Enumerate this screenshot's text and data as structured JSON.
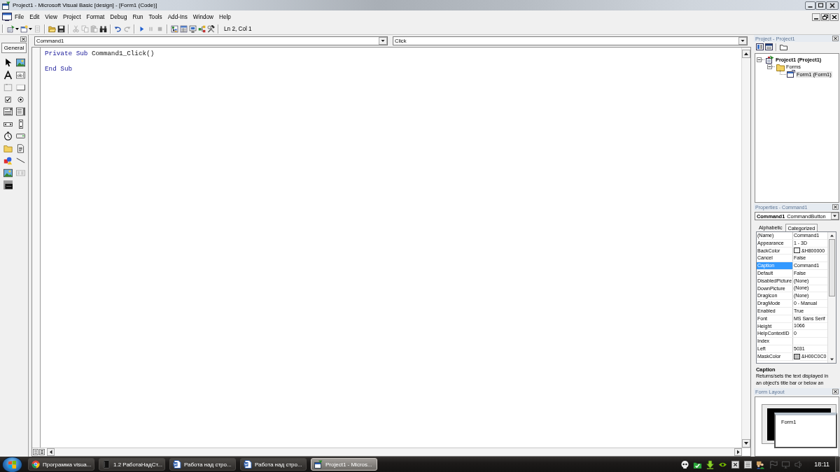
{
  "window": {
    "title": "Project1 - Microsoft Visual Basic [design] - [Form1 (Code)]"
  },
  "menu_bar": {
    "items": [
      "File",
      "Edit",
      "View",
      "Project",
      "Format",
      "Debug",
      "Run",
      "Tools",
      "Add-Ins",
      "Window",
      "Help"
    ]
  },
  "toolbar": {
    "buttons": [
      {
        "disabled": false
      },
      {
        "disabled": false
      },
      {
        "disabled": true
      },
      {
        "disabled": false
      },
      {
        "disabled": false
      },
      {
        "disabled": true
      },
      {
        "disabled": true
      },
      {
        "disabled": true
      },
      {
        "disabled": false
      },
      {
        "disabled": false
      },
      {
        "disabled": true
      },
      {
        "disabled": false
      },
      {
        "disabled": true
      },
      {
        "disabled": true
      },
      {
        "disabled": false
      },
      {
        "disabled": false
      },
      {
        "disabled": false
      },
      {
        "disabled": false
      },
      {
        "disabled": false
      }
    ],
    "position": "Ln 2, Col 1"
  },
  "toolbox": {
    "tab": "General"
  },
  "code_window": {
    "object": "Command1",
    "procedure": "Click",
    "lines": [
      {
        "kind": "code",
        "tokens": [
          {
            "text": "Private Sub",
            "kind": "keyword"
          },
          {
            "text": " Command1_Click()",
            "kind": "plain"
          }
        ]
      },
      {
        "kind": "blank"
      },
      {
        "kind": "code",
        "tokens": [
          {
            "text": "End Sub",
            "kind": "keyword"
          }
        ]
      }
    ]
  },
  "project_explorer": {
    "title": "Project - Project1",
    "tree": [
      {
        "label": "Project1 (Project1)",
        "kind": "project",
        "expanded": true,
        "selected": false,
        "children": [
          {
            "label": "Forms",
            "kind": "folder",
            "expanded": true,
            "selected": false,
            "children": [
              {
                "label": "Form1 (Form1)",
                "kind": "form",
                "selected": true
              }
            ]
          }
        ]
      }
    ]
  },
  "properties": {
    "title": "Properties - Command1",
    "object": {
      "name": "Command1",
      "type": "CommandButton"
    },
    "tabs": [
      {
        "label": "Alphabetic",
        "selected": true
      },
      {
        "label": "Categorized",
        "selected": false
      }
    ],
    "rows": [
      {
        "name": "(Name)",
        "value": "Command1",
        "selected": false
      },
      {
        "name": "Appearance",
        "value": "1 - 3D",
        "selected": false
      },
      {
        "name": "BackColor",
        "value": "&H800000",
        "color": "#f4f4f4",
        "selected": false
      },
      {
        "name": "Cancel",
        "value": "False",
        "selected": false
      },
      {
        "name": "Caption",
        "value": "Command1",
        "selected": true
      },
      {
        "name": "Default",
        "value": "False",
        "selected": false
      },
      {
        "name": "DisabledPicture",
        "value": "(None)",
        "selected": false
      },
      {
        "name": "DownPicture",
        "value": "(None)",
        "selected": false
      },
      {
        "name": "DragIcon",
        "value": "(None)",
        "selected": false
      },
      {
        "name": "DragMode",
        "value": "0 - Manual",
        "selected": false
      },
      {
        "name": "Enabled",
        "value": "True",
        "selected": false
      },
      {
        "name": "Font",
        "value": "MS Sans Serif",
        "selected": false
      },
      {
        "name": "Height",
        "value": "1066",
        "selected": false
      },
      {
        "name": "HelpContextID",
        "value": "0",
        "selected": false
      },
      {
        "name": "Index",
        "selected": false
      },
      {
        "name": "Left",
        "value": "5031",
        "selected": false
      },
      {
        "name": "MaskColor",
        "value": "&H00C0C0",
        "color": "#c0c0c0",
        "selected": false
      }
    ],
    "description": {
      "title": "Caption",
      "lines": [
        "Returns/sets the text displayed in",
        "an object's title bar or below an"
      ]
    }
  },
  "form_layout": {
    "title": "Form Layout",
    "form_caption": "Form1"
  },
  "taskbar": {
    "buttons": [
      {
        "label": "Программа visua...",
        "kind": "browser",
        "selected": false
      },
      {
        "label": "1.2 РаботаНадСт...",
        "kind": "book",
        "selected": false
      },
      {
        "label": "Работа над стро...",
        "kind": "document",
        "selected": false
      },
      {
        "label": "Работа над стро...",
        "kind": "document",
        "selected": false
      },
      {
        "label": "Project1 - Micros...",
        "kind": "window",
        "selected": true
      }
    ],
    "clock": "18:11"
  }
}
